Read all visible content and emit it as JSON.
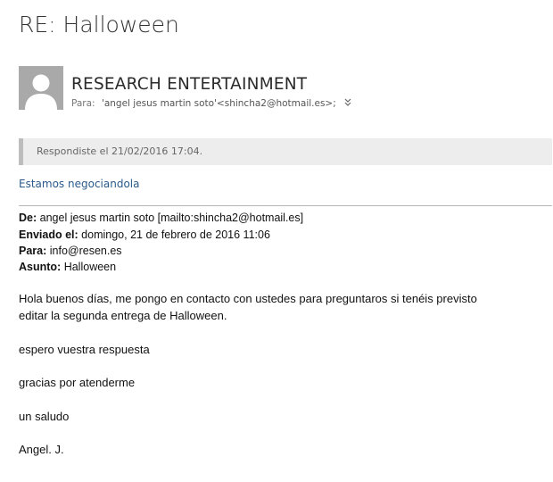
{
  "message": {
    "subject": "RE: Halloween",
    "sender_name": "RESEARCH ENTERTAINMENT",
    "to_label": "Para:",
    "to_value": "'angel jesus martin soto'<shincha2@hotmail.es>;",
    "expand_icon": "chevron-double-down-icon",
    "replied_banner": "Respondiste el 21/02/2016 17:04.",
    "reply_note": "Estamos negociandola"
  },
  "quoted": {
    "from_label": "De:",
    "from_value": "angel jesus martin soto [mailto:shincha2@hotmail.es]",
    "sent_label": "Enviado el:",
    "sent_value": "domingo, 21 de febrero de 2016 11:06",
    "to_label": "Para:",
    "to_value": "info@resen.es",
    "subject_label": "Asunto:",
    "subject_value": "Halloween",
    "body_line_1": "Hola buenos días, me pongo en contacto con ustedes para  preguntaros si tenéis previsto",
    "body_line_2": "editar la segunda entrega de Halloween.",
    "body_line_3": "espero vuestra respuesta",
    "body_line_4": "gracias por atenderme",
    "body_line_5": "un saludo",
    "signature": "Angel. J."
  },
  "colors": {
    "avatar_bg": "#a9a9a9",
    "banner_bg": "#ededed",
    "banner_bar": "#bdbdbd",
    "note_text": "#2a5a8c"
  }
}
